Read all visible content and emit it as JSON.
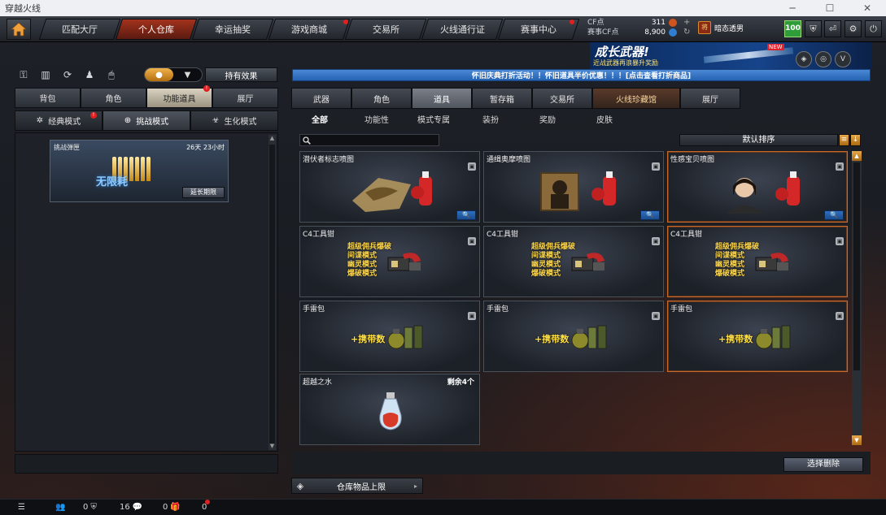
{
  "window": {
    "title": "穿越火线"
  },
  "nav": {
    "tabs": [
      {
        "label": "匹配大厅"
      },
      {
        "label": "个人仓库"
      },
      {
        "label": "幸运抽奖"
      },
      {
        "label": "游戏商城"
      },
      {
        "label": "交易所"
      },
      {
        "label": "火线通行证"
      },
      {
        "label": "赛事中心"
      }
    ],
    "cf_label": "CF点",
    "cf_value": "311",
    "event_cf_label": "赛事CF点",
    "event_cf_value": "8,900",
    "username": "暗态透男",
    "level": "100"
  },
  "banner": {
    "headline": "成长武器!",
    "sub": "近战武器再浪暴升奖励",
    "new_tag": "NEW"
  },
  "marquee": "怀旧庆典打折活动！！怀旧道具半价优惠！！！[点击查看打折商品]",
  "left": {
    "toggle_icons": [
      "●",
      "▼"
    ],
    "hold_effect": "持有效果",
    "tabs": [
      {
        "label": "背包"
      },
      {
        "label": "角色"
      },
      {
        "label": "功能道具"
      },
      {
        "label": "展厅"
      }
    ],
    "modes": [
      {
        "label": "经典模式"
      },
      {
        "label": "挑战模式"
      },
      {
        "label": "生化模式"
      }
    ],
    "item": {
      "title": "挑战弹匣",
      "time": "26天 23小时",
      "badge": "无限耗",
      "extend": "延长期限"
    }
  },
  "right": {
    "tabs": [
      {
        "label": "武器"
      },
      {
        "label": "角色"
      },
      {
        "label": "道具"
      },
      {
        "label": "暂存箱"
      },
      {
        "label": "交易所"
      },
      {
        "label": "火线珍藏馆"
      },
      {
        "label": "展厅"
      }
    ],
    "subtabs": [
      {
        "label": "全部"
      },
      {
        "label": "功能性"
      },
      {
        "label": "模式专属"
      },
      {
        "label": "装扮"
      },
      {
        "label": "奖励"
      },
      {
        "label": "皮肤"
      }
    ],
    "sort_label": "默认排序",
    "items": [
      {
        "title": "潜伏者标志喷图"
      },
      {
        "title": "通缉奥摩喷图"
      },
      {
        "title": "性感宝贝喷图"
      },
      {
        "title": "C4工具钳",
        "lines": [
          "超级佣兵爆破",
          "间谍模式",
          "幽灵模式",
          "爆破模式"
        ]
      },
      {
        "title": "C4工具钳",
        "lines": [
          "超级佣兵爆破",
          "间谍模式",
          "幽灵模式",
          "爆破模式"
        ]
      },
      {
        "title": "C4工具钳",
        "lines": [
          "超级佣兵爆破",
          "间谍模式",
          "幽灵模式",
          "爆破模式"
        ]
      },
      {
        "title": "手雷包",
        "carry": "+携带数"
      },
      {
        "title": "手雷包",
        "carry": "+携带数"
      },
      {
        "title": "手雷包",
        "carry": "+携带数"
      },
      {
        "title": "超越之水",
        "remain": "剩余4个"
      }
    ],
    "delete_btn": "选择删除",
    "limit_btn": "仓库物品上限"
  },
  "status": {
    "v1": "0",
    "v2": "16",
    "v3": "0",
    "v4": "0"
  }
}
